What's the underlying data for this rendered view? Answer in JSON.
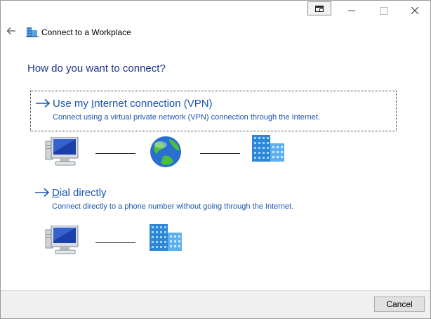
{
  "window": {
    "title": "Connect to a Workplace",
    "controls": [
      "snap-icon",
      "minimize-icon",
      "maximize-icon",
      "close-icon"
    ]
  },
  "question": "How do you want to connect?",
  "options": [
    {
      "title_pre": "Use my ",
      "title_access": "I",
      "title_post": "nternet connection (VPN)",
      "description": "Connect using a virtual private network (VPN) connection through the Internet.",
      "icons": [
        "computer-icon",
        "globe-icon",
        "workplace-building-icon"
      ]
    },
    {
      "title_pre": "",
      "title_access": "D",
      "title_post": "ial directly",
      "description": "Connect directly to a phone number without going through the Internet.",
      "icons": [
        "computer-icon",
        "workplace-building-icon"
      ]
    }
  ],
  "footer": {
    "cancel_label": "Cancel"
  },
  "colors": {
    "heading": "#1e3287",
    "link": "#1a55b0",
    "footer_bg": "#f0f0f0"
  }
}
